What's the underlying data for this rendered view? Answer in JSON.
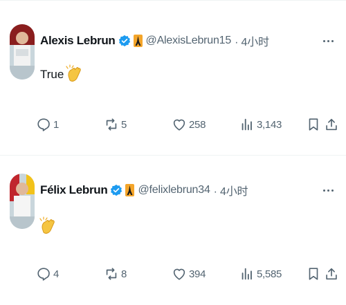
{
  "tweets": [
    {
      "name": "Alexis Lebrun",
      "handle": "@AlexisLebrun15",
      "time": "· 4小时",
      "text": "True",
      "actions": {
        "replies": "1",
        "reposts": "5",
        "likes": "258",
        "views": "3,143"
      }
    },
    {
      "name": "Félix Lebrun",
      "handle": "@felixlebrun34",
      "time": "· 4小时",
      "text": "",
      "actions": {
        "replies": "4",
        "reposts": "8",
        "likes": "394",
        "views": "5,585"
      }
    }
  ],
  "colors": {
    "verified": "#1d9bf0",
    "muted": "#536471",
    "text": "#0f1419",
    "clap": "#f5c542"
  },
  "icons": [
    "verified-icon",
    "eiffel-tower-icon",
    "more-icon",
    "reply-icon",
    "repost-icon",
    "like-icon",
    "views-icon",
    "bookmark-icon",
    "share-icon",
    "clap-emoji"
  ]
}
